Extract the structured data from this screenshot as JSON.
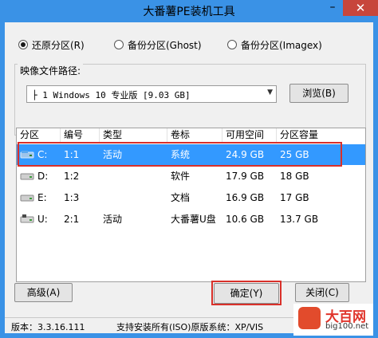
{
  "window": {
    "title": "大番薯PE装机工具",
    "min_glyph": "–",
    "close_glyph": "✕"
  },
  "modes": [
    {
      "label": "还原分区(R)",
      "checked": true
    },
    {
      "label": "备份分区(Ghost)",
      "checked": false
    },
    {
      "label": "备份分区(Imagex)",
      "checked": false
    }
  ],
  "image_path": {
    "label": "映像文件路径:",
    "value": "├ 1 Windows 10 专业版 [9.03 GB]",
    "browse_label": "浏览(B)"
  },
  "partition_table": {
    "columns": [
      "分区",
      "编号",
      "类型",
      "卷标",
      "可用空间",
      "分区容量"
    ],
    "rows": [
      {
        "drive": "C:",
        "num": "1:1",
        "type": "活动",
        "label": "系统",
        "free": "24.9 GB",
        "size": "25 GB",
        "selected": true,
        "icon": "system-drive-icon"
      },
      {
        "drive": "D:",
        "num": "1:2",
        "type": "",
        "label": "软件",
        "free": "17.9 GB",
        "size": "18 GB",
        "selected": false,
        "icon": "hard-drive-icon"
      },
      {
        "drive": "E:",
        "num": "1:3",
        "type": "",
        "label": "文档",
        "free": "16.9 GB",
        "size": "17 GB",
        "selected": false,
        "icon": "hard-drive-icon"
      },
      {
        "drive": "U:",
        "num": "2:1",
        "type": "活动",
        "label": "大番薯U盘",
        "free": "10.6 GB",
        "size": "13.7 GB",
        "selected": false,
        "icon": "usb-drive-icon"
      }
    ]
  },
  "buttons": {
    "advanced": "高级(A)",
    "confirm": "确定(Y)",
    "close": "关闭(C)"
  },
  "status": {
    "version": "版本：3.3.16.111",
    "info": "支持安装所有(ISO)原版系统：XP/VIS"
  },
  "watermark": {
    "name": "大百网",
    "url": "big100.net"
  },
  "colors": {
    "title_bar": "#3a92e6",
    "selection": "#3399ff",
    "highlight_box": "#d9302a",
    "close_button": "#c7463b"
  }
}
